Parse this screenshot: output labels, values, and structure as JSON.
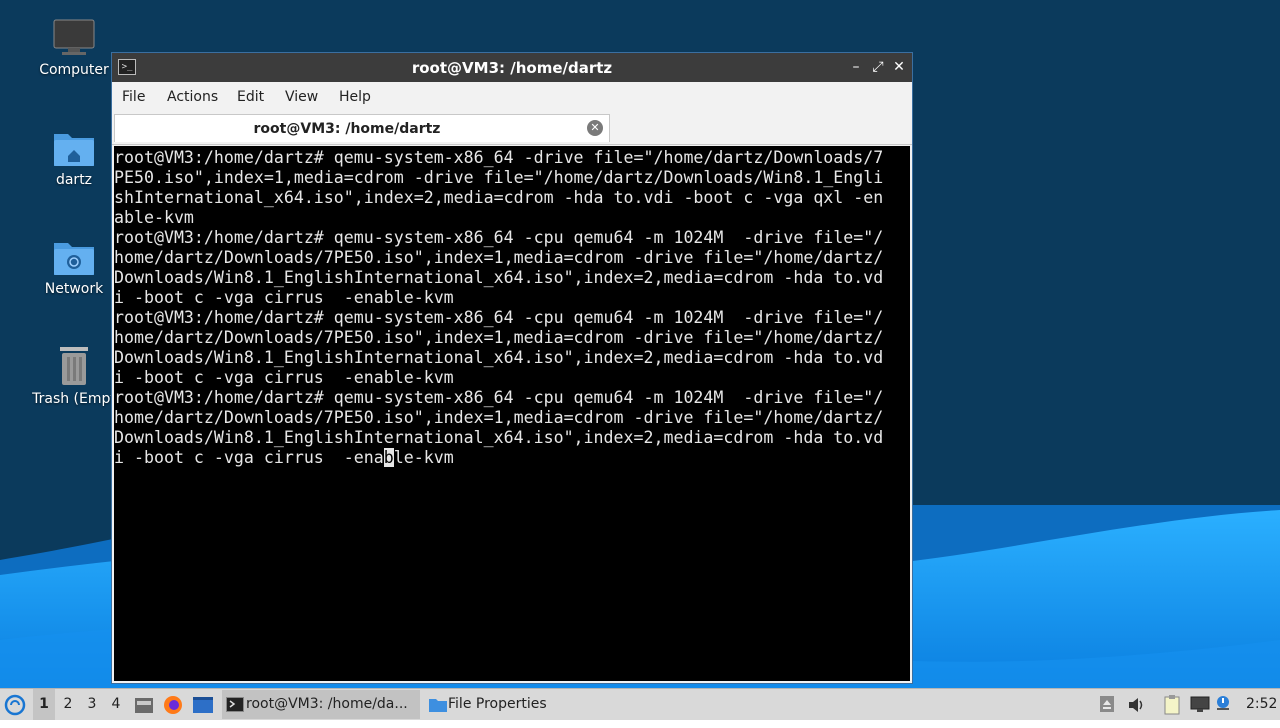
{
  "desktop": {
    "icons": [
      {
        "label": "Computer",
        "icon": "computer-icon"
      },
      {
        "label": "dartz",
        "icon": "home-folder-icon"
      },
      {
        "label": "Network",
        "icon": "network-folder-icon"
      },
      {
        "label": "Trash (Empt",
        "icon": "trash-icon"
      }
    ]
  },
  "window": {
    "title": "root@VM3: /home/dartz",
    "controls": {
      "minimize": "–",
      "maximize": "⤢",
      "close": "✕"
    },
    "menu": [
      "File",
      "Actions",
      "Edit",
      "View",
      "Help"
    ],
    "tab": {
      "label": "root@VM3: /home/dartz",
      "close": "✕"
    },
    "terminal_lines": [
      "root@VM3:/home/dartz# qemu-system-x86_64 -drive file=\"/home/dartz/Downloads/7",
      "PE50.iso\",index=1,media=cdrom -drive file=\"/home/dartz/Downloads/Win8.1_Engli",
      "shInternational_x64.iso\",index=2,media=cdrom -hda to.vdi -boot c -vga qxl -en",
      "able-kvm",
      "root@VM3:/home/dartz# qemu-system-x86_64 -cpu qemu64 -m 1024M  -drive file=\"/",
      "home/dartz/Downloads/7PE50.iso\",index=1,media=cdrom -drive file=\"/home/dartz/",
      "Downloads/Win8.1_EnglishInternational_x64.iso\",index=2,media=cdrom -hda to.vd",
      "i -boot c -vga cirrus  -enable-kvm",
      "root@VM3:/home/dartz# qemu-system-x86_64 -cpu qemu64 -m 1024M  -drive file=\"/",
      "home/dartz/Downloads/7PE50.iso\",index=1,media=cdrom -drive file=\"/home/dartz/",
      "Downloads/Win8.1_EnglishInternational_x64.iso\",index=2,media=cdrom -hda to.vd",
      "i -boot c -vga cirrus  -enable-kvm",
      "root@VM3:/home/dartz# qemu-system-x86_64 -cpu qemu64 -m 1024M  -drive file=\"/",
      "home/dartz/Downloads/7PE50.iso\",index=1,media=cdrom -drive file=\"/home/dartz/",
      "Downloads/Win8.1_EnglishInternational_x64.iso\",index=2,media=cdrom -hda to.vd"
    ],
    "last_line": {
      "before": "i -boot c -vga cirrus  -ena",
      "cursor": "b",
      "after": "le-kvm"
    }
  },
  "taskbar": {
    "workspaces": [
      "1",
      "2",
      "3",
      "4"
    ],
    "active_workspace": "1",
    "tasks": [
      {
        "label": "root@VM3: /home/da...",
        "icon": "terminal-icon",
        "active": true
      },
      {
        "label": "File Properties",
        "icon": "folder-icon",
        "active": false
      }
    ],
    "clock": "2:52"
  },
  "colors": {
    "desktop_bg": "#0b3a5c",
    "wave_light": "#1aa3ff",
    "titlebar": "#3c3c3c",
    "terminal_bg": "#000000",
    "terminal_fg": "#e6e6e6",
    "taskbar_bg": "#d9d9d9"
  }
}
